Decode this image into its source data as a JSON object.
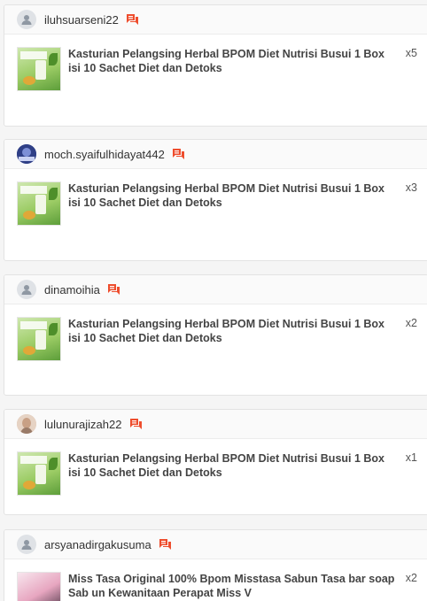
{
  "colors": {
    "chat_icon": "#ee4d2d",
    "card_border": "#e3e3e3",
    "header_bg": "#fafafa"
  },
  "orders": [
    {
      "username": "iluhsuarseni22",
      "avatar": "default-avatar-icon",
      "chat_icon": "chat-icon",
      "product_name": "Kasturian Pelangsing Herbal BPOM Diet Nutrisi Busui 1 Box isi 10 Sachet Diet dan Detoks",
      "quantity": "x5"
    },
    {
      "username": "moch.syaifulhidayat442",
      "avatar": "user-photo-avatar",
      "chat_icon": "chat-icon",
      "product_name": "Kasturian Pelangsing Herbal BPOM Diet Nutrisi Busui 1 Box isi 10 Sachet Diet dan Detoks",
      "quantity": "x3"
    },
    {
      "username": "dinamoihia",
      "avatar": "default-avatar-icon",
      "chat_icon": "chat-icon",
      "product_name": "Kasturian Pelangsing Herbal BPOM Diet Nutrisi Busui 1 Box isi 10 Sachet Diet dan Detoks",
      "quantity": "x2"
    },
    {
      "username": "lulunurajizah22",
      "avatar": "user-photo-avatar",
      "chat_icon": "chat-icon",
      "product_name": "Kasturian Pelangsing Herbal BPOM Diet Nutrisi Busui 1 Box isi 10 Sachet Diet dan Detoks",
      "quantity": "x1"
    },
    {
      "username": "arsyanadirgakusuma",
      "avatar": "default-avatar-icon",
      "chat_icon": "chat-icon",
      "product_name": "Miss Tasa Original 100% Bpom Misstasa Sabun Tasa bar soap Sab un Kewanitaan Perapat Miss V",
      "quantity": "x2"
    }
  ]
}
